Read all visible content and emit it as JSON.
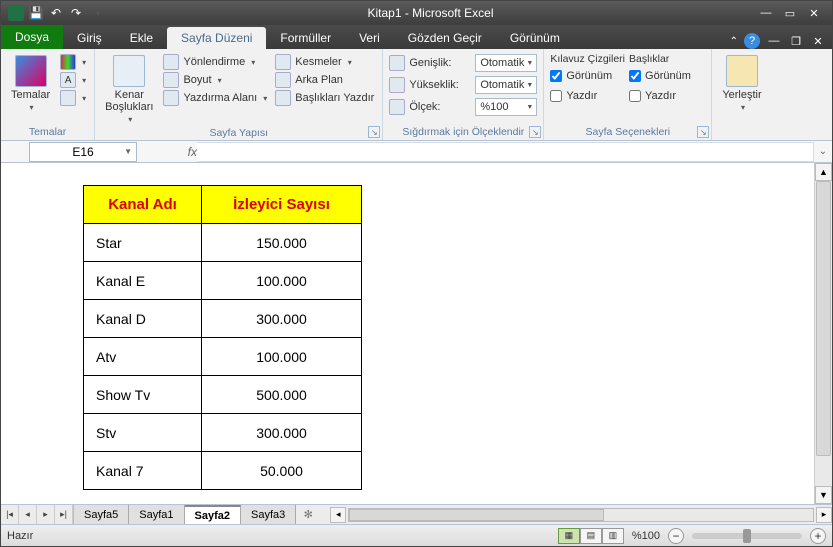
{
  "title": "Kitap1 - Microsoft Excel",
  "tabs": {
    "file": "Dosya",
    "items": [
      "Giriş",
      "Ekle",
      "Sayfa Düzeni",
      "Formüller",
      "Veri",
      "Gözden Geçir",
      "Görünüm"
    ],
    "active_index": 2
  },
  "ribbon": {
    "themes": {
      "label": "Temalar",
      "btn": "Temalar"
    },
    "page_setup": {
      "label": "Sayfa Yapısı",
      "margins": "Kenar\nBoşlukları",
      "items": [
        "Yönlendirme",
        "Boyut",
        "Yazdırma Alanı",
        "Kesmeler",
        "Arka Plan",
        "Başlıkları Yazdır"
      ]
    },
    "scale_fit": {
      "label": "Sığdırmak için Ölçeklendir",
      "width_lbl": "Genişlik:",
      "height_lbl": "Yükseklik:",
      "scale_lbl": "Ölçek:",
      "auto": "Otomatik",
      "scale_val": "%100"
    },
    "sheet_opts": {
      "label": "Sayfa Seçenekleri",
      "col1_head": "Kılavuz Çizgileri",
      "col2_head": "Başlıklar",
      "view": "Görünüm",
      "print": "Yazdır"
    },
    "arrange": {
      "btn": "Yerleştir"
    }
  },
  "namebox": "E16",
  "table": {
    "headers": [
      "Kanal Adı",
      "İzleyici Sayısı"
    ],
    "rows": [
      [
        "Star",
        "150.000"
      ],
      [
        "Kanal E",
        "100.000"
      ],
      [
        "Kanal D",
        "300.000"
      ],
      [
        "Atv",
        "100.000"
      ],
      [
        "Show Tv",
        "500.000"
      ],
      [
        "Stv",
        "300.000"
      ],
      [
        "Kanal 7",
        "50.000"
      ]
    ]
  },
  "sheets": {
    "items": [
      "Sayfa5",
      "Sayfa1",
      "Sayfa2",
      "Sayfa3"
    ],
    "active_index": 2
  },
  "status": {
    "ready": "Hazır",
    "zoom": "%100"
  }
}
